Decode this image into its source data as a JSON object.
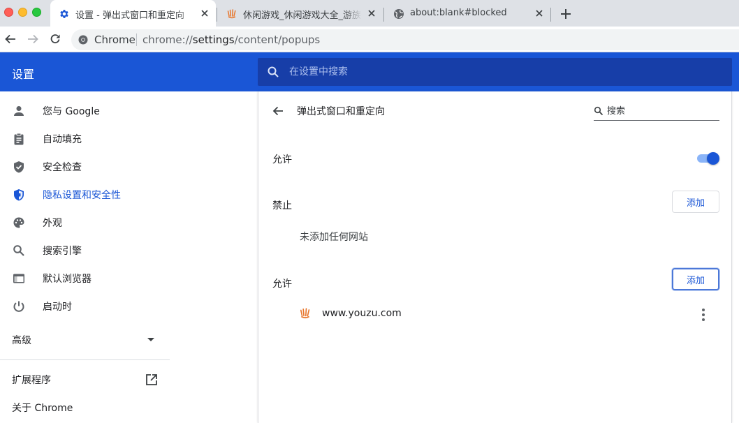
{
  "window": {
    "tabs": [
      {
        "title": "设置 - 弹出式窗口和重定向",
        "icon": "gear-icon",
        "active": true
      },
      {
        "title": "休闲游戏_休闲游戏大全_游族休闲游戏",
        "icon": "youzu-favicon",
        "active": false
      },
      {
        "title": "about:blank#blocked",
        "icon": "globe-icon",
        "active": false
      }
    ],
    "new_tab_icon": "plus-icon"
  },
  "toolbar": {
    "omnibox": {
      "site_label": "Chrome",
      "url_prefix": "chrome://",
      "url_host": "settings",
      "url_path": "/content/popups"
    }
  },
  "settings_header": {
    "title": "设置",
    "search_placeholder": "在设置中搜索"
  },
  "sidebar": {
    "items": [
      {
        "label": "您与 Google",
        "icon": "person-icon"
      },
      {
        "label": "自动填充",
        "icon": "clipboard-icon"
      },
      {
        "label": "安全检查",
        "icon": "shield-check-icon"
      },
      {
        "label": "隐私设置和安全性",
        "icon": "shield-icon",
        "active": true
      },
      {
        "label": "外观",
        "icon": "palette-icon"
      },
      {
        "label": "搜索引擎",
        "icon": "search-icon"
      },
      {
        "label": "默认浏览器",
        "icon": "browser-icon"
      },
      {
        "label": "启动时",
        "icon": "power-icon"
      }
    ],
    "advanced_label": "高级",
    "extensions_label": "扩展程序",
    "about_label": "关于 Chrome"
  },
  "page": {
    "title": "弹出式窗口和重定向",
    "search_placeholder": "搜索",
    "default_label": "允许",
    "default_enabled": true,
    "blocked": {
      "label": "禁止",
      "add_label": "添加",
      "empty_text": "未添加任何网站"
    },
    "allowed": {
      "label": "允许",
      "add_label": "添加",
      "sites": [
        {
          "url": "www.youzu.com",
          "icon": "youzu-favicon"
        }
      ]
    }
  },
  "colors": {
    "accent": "#1a56d6",
    "header_bg": "#1a56d6",
    "search_bg": "#173ea8",
    "tabstrip_bg": "#dee1e6"
  }
}
